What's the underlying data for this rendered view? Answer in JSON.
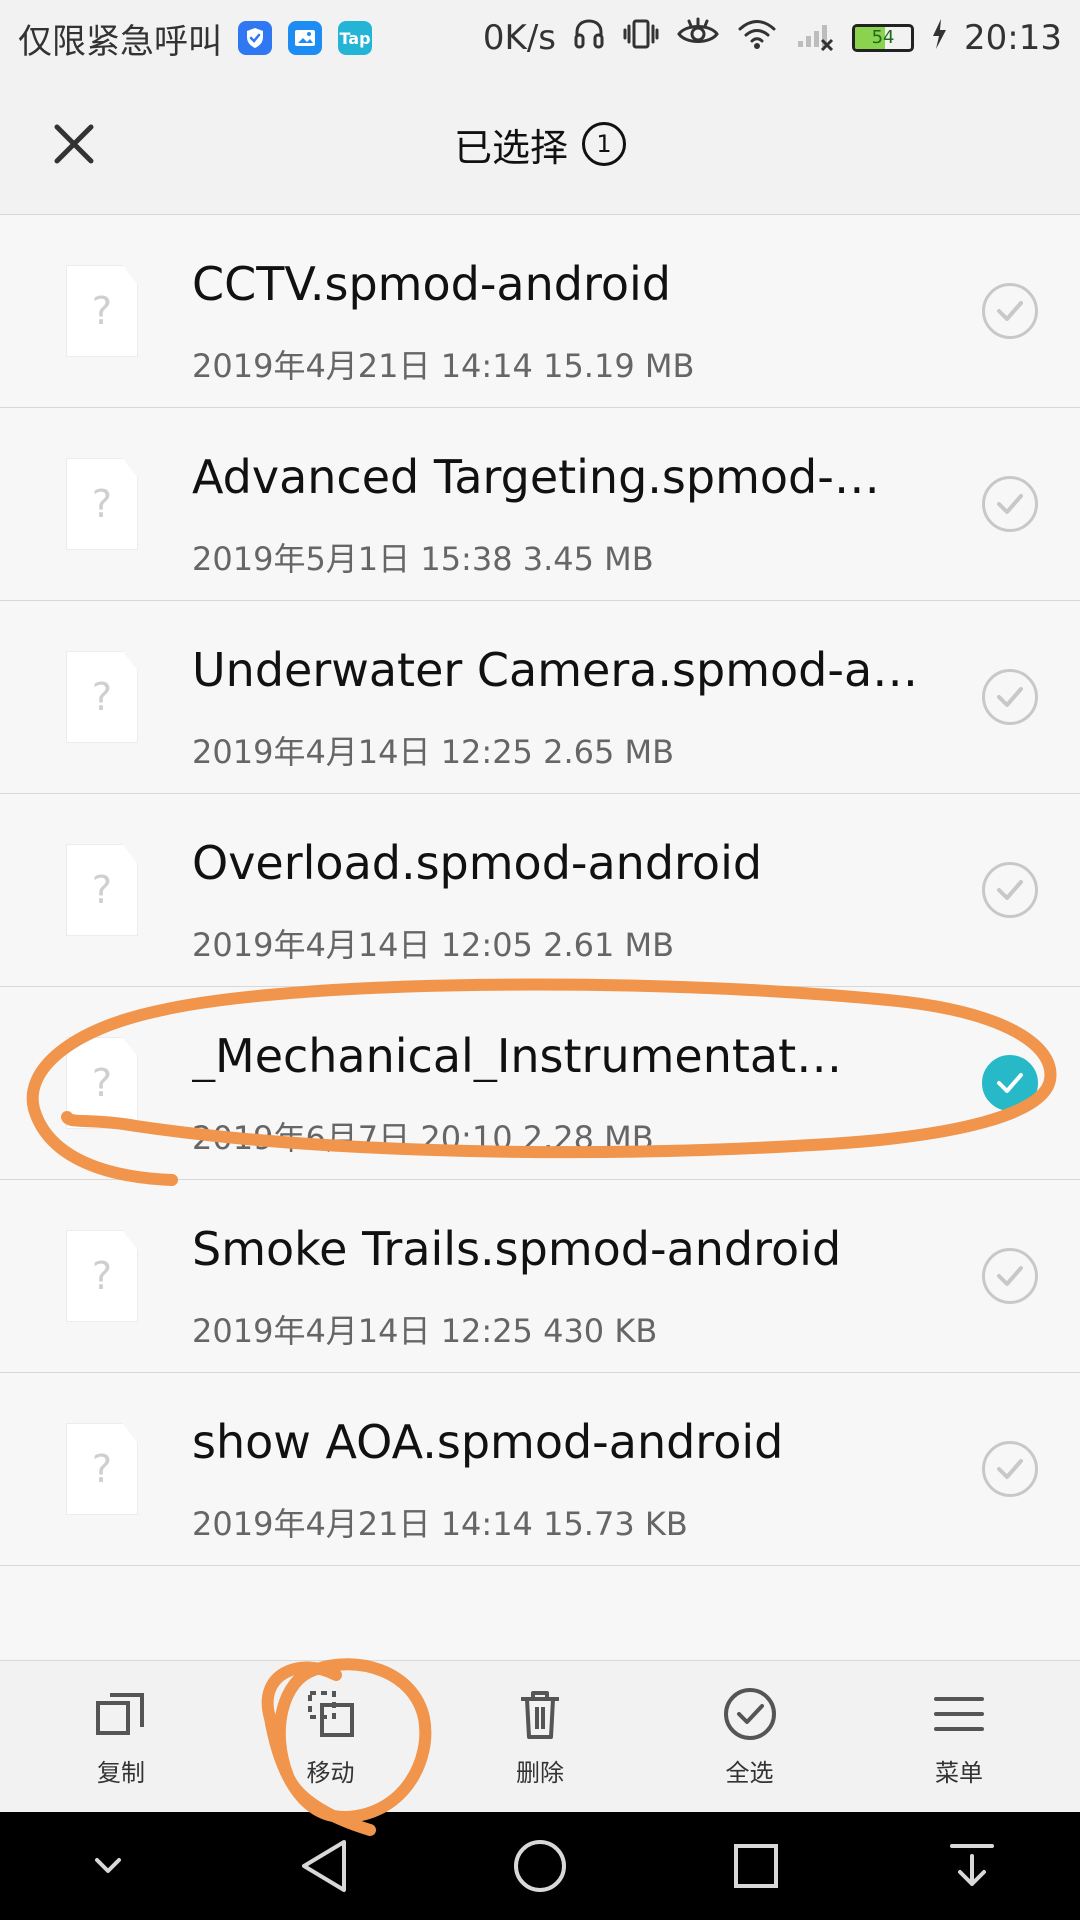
{
  "status_bar": {
    "emergency": "仅限紧急呼叫",
    "speed": "0K/s",
    "battery_level": "54",
    "time": "20:13",
    "app_icons": [
      "shield-icon",
      "gallery-icon",
      "tap-icon"
    ],
    "tap_label": "Tap"
  },
  "header": {
    "title": "已选择",
    "count": "1"
  },
  "files": [
    {
      "name": "CCTV.spmod-android",
      "meta": "2019年4月21日 14:14 15.19 MB",
      "selected": false
    },
    {
      "name": "Advanced Targeting.spmod-…",
      "meta": "2019年5月1日 15:38 3.45 MB",
      "selected": false
    },
    {
      "name": "Underwater Camera.spmod-a…",
      "meta": "2019年4月14日 12:25 2.65 MB",
      "selected": false
    },
    {
      "name": "Overload.spmod-android",
      "meta": "2019年4月14日 12:05 2.61 MB",
      "selected": false
    },
    {
      "name": "_Mechanical_Instrumentat…",
      "meta": "2019年6月7日 20:10 2.28 MB",
      "selected": true
    },
    {
      "name": "Smoke Trails.spmod-android",
      "meta": "2019年4月14日 12:25 430 KB",
      "selected": false
    },
    {
      "name": "show AOA.spmod-android",
      "meta": "2019年4月21日 14:14 15.73 KB",
      "selected": false
    }
  ],
  "actions": [
    {
      "label": "复制",
      "icon": "copy-icon"
    },
    {
      "label": "移动",
      "icon": "move-icon"
    },
    {
      "label": "删除",
      "icon": "delete-icon"
    },
    {
      "label": "全选",
      "icon": "select-all-icon"
    },
    {
      "label": "菜单",
      "icon": "menu-icon"
    }
  ],
  "navigation": [
    "chevron-down-icon",
    "back-icon",
    "home-icon",
    "recents-icon",
    "notification-pull-icon"
  ],
  "colors": {
    "accent": "#27b9c8",
    "annotation": "#f0954b",
    "status_blue": "#1d8df3",
    "battery_green": "#8bd34f"
  }
}
